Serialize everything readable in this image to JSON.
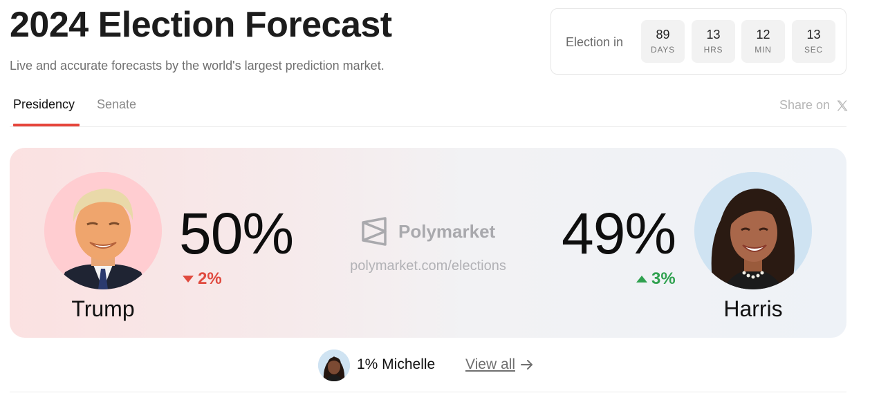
{
  "header": {
    "title": "2024 Election Forecast",
    "subtitle": "Live and accurate forecasts by the world's largest prediction market."
  },
  "countdown": {
    "label": "Election in",
    "units": [
      {
        "value": "89",
        "unit": "DAYS"
      },
      {
        "value": "13",
        "unit": "HRS"
      },
      {
        "value": "12",
        "unit": "MIN"
      },
      {
        "value": "13",
        "unit": "SEC"
      }
    ]
  },
  "tabs": [
    {
      "label": "Presidency",
      "active": true
    },
    {
      "label": "Senate",
      "active": false
    }
  ],
  "share": {
    "label": "Share on",
    "icon": "x-logo-icon"
  },
  "forecast": {
    "left": {
      "name": "Trump",
      "percent": "50%",
      "change": "2%",
      "direction": "down"
    },
    "right": {
      "name": "Harris",
      "percent": "49%",
      "change": "3%",
      "direction": "up"
    },
    "brand": {
      "name": "Polymarket",
      "url": "polymarket.com/elections"
    }
  },
  "others": {
    "text": "1% Michelle",
    "view_all": "View all"
  },
  "colors": {
    "accent": "#e6453b",
    "down": "#e04a3f",
    "up": "#2fa14f",
    "left_avatar_bg": "#ffcdd1",
    "right_avatar_bg": "#cfe3f2"
  }
}
